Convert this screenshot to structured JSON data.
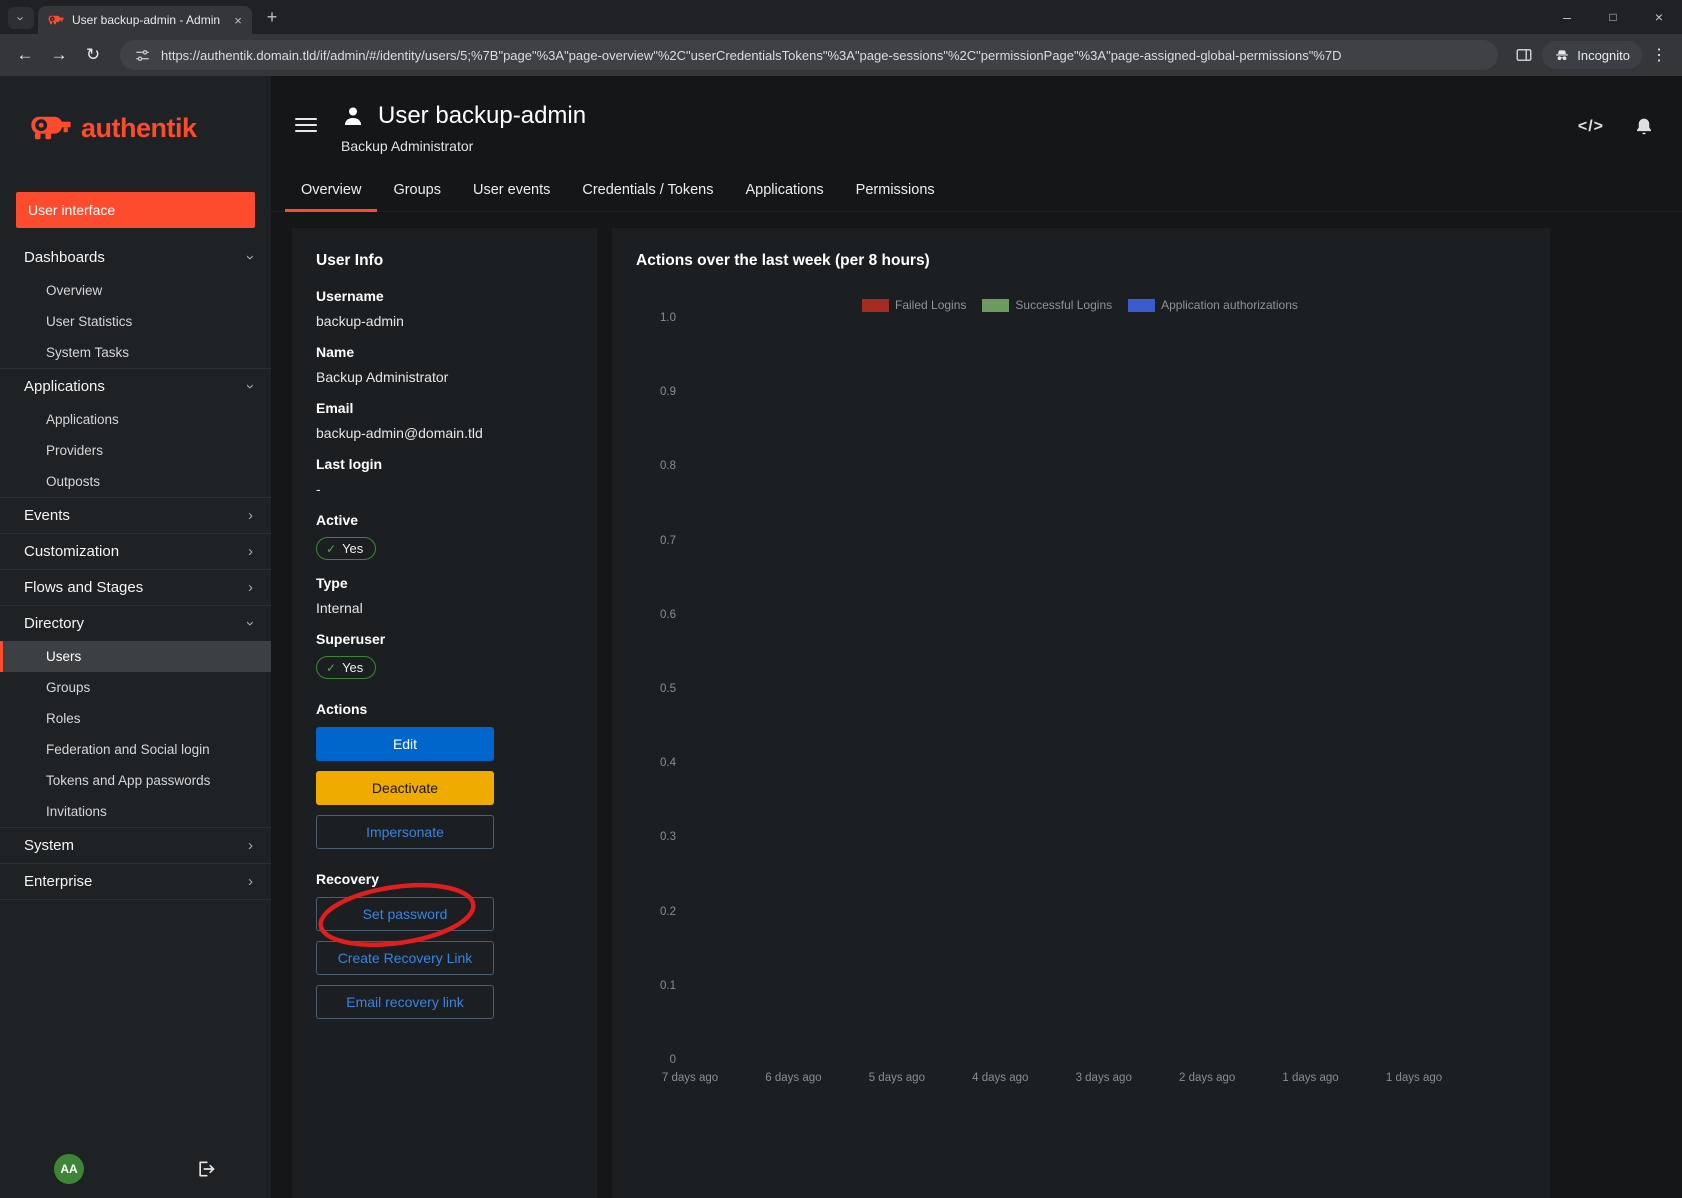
{
  "browser": {
    "tab_title": "User backup-admin - Admin - a",
    "url": "https://authentik.domain.tld/if/admin/#/identity/users/5;%7B\"page\"%3A\"page-overview\"%2C\"userCredentialsTokens\"%3A\"page-sessions\"%2C\"permissionPage\"%3A\"page-assigned-global-permissions\"%7D",
    "incognito_label": "Incognito"
  },
  "icons": {
    "tab_search_chevron": "›",
    "close_tab": "×",
    "new_tab": "+",
    "minimize": "–",
    "maximize": "□",
    "close_window": "×",
    "back": "←",
    "forward": "→",
    "reload": "↻",
    "menu": "⋮",
    "chevron": "›",
    "check": "✓",
    "code": "</>"
  },
  "colors": {
    "accent": "#fd4b2d",
    "primary_button": "#0066cc",
    "warning_button": "#f0ab00",
    "link": "#3a83de",
    "success": "#3e8635",
    "annotation": "#e01e1e"
  },
  "sidebar": {
    "brand": "authentik",
    "interface_button": "User interface",
    "sections": [
      {
        "label": "Dashboards",
        "state": "expanded",
        "children": [
          {
            "label": "Overview"
          },
          {
            "label": "User Statistics"
          },
          {
            "label": "System Tasks"
          }
        ]
      },
      {
        "label": "Applications",
        "state": "expanded",
        "children": [
          {
            "label": "Applications"
          },
          {
            "label": "Providers"
          },
          {
            "label": "Outposts"
          }
        ]
      },
      {
        "label": "Events",
        "state": "collapsed",
        "children": []
      },
      {
        "label": "Customization",
        "state": "collapsed",
        "children": []
      },
      {
        "label": "Flows and Stages",
        "state": "collapsed",
        "children": []
      },
      {
        "label": "Directory",
        "state": "expanded",
        "children": [
          {
            "label": "Users",
            "selected": true
          },
          {
            "label": "Groups"
          },
          {
            "label": "Roles"
          },
          {
            "label": "Federation and Social login"
          },
          {
            "label": "Tokens and App passwords"
          },
          {
            "label": "Invitations"
          }
        ]
      },
      {
        "label": "System",
        "state": "collapsed",
        "children": []
      },
      {
        "label": "Enterprise",
        "state": "collapsed",
        "children": []
      }
    ],
    "avatar_initials": "AA"
  },
  "header": {
    "title": "User backup-admin",
    "subtitle": "Backup Administrator"
  },
  "tabs": [
    {
      "label": "Overview",
      "active": true
    },
    {
      "label": "Groups"
    },
    {
      "label": "User events"
    },
    {
      "label": "Credentials / Tokens"
    },
    {
      "label": "Applications"
    },
    {
      "label": "Permissions"
    }
  ],
  "user_info": {
    "title": "User Info",
    "fields": [
      {
        "label": "Username",
        "value": "backup-admin"
      },
      {
        "label": "Name",
        "value": "Backup Administrator"
      },
      {
        "label": "Email",
        "value": "backup-admin@domain.tld"
      },
      {
        "label": "Last login",
        "value": "-"
      },
      {
        "label": "Active",
        "badge": "Yes"
      },
      {
        "label": "Type",
        "value": "Internal"
      },
      {
        "label": "Superuser",
        "badge": "Yes"
      }
    ],
    "actions_label": "Actions",
    "actions": [
      {
        "label": "Edit",
        "style": "primary"
      },
      {
        "label": "Deactivate",
        "style": "warning"
      },
      {
        "label": "Impersonate",
        "style": "outline"
      }
    ],
    "recovery_label": "Recovery",
    "recovery": [
      {
        "label": "Set password",
        "style": "outline",
        "annotated": true
      },
      {
        "label": "Create Recovery Link",
        "style": "outline"
      },
      {
        "label": "Email recovery link",
        "style": "outline"
      }
    ]
  },
  "chart_data": {
    "type": "line",
    "title": "Actions over the last week (per 8 hours)",
    "x": [
      "7 days ago",
      "6 days ago",
      "5 days ago",
      "4 days ago",
      "3 days ago",
      "2 days ago",
      "1 days ago",
      "1 days ago"
    ],
    "series": [
      {
        "name": "Failed Logins",
        "color": "#a52a1f",
        "values": [
          0,
          0,
          0,
          0,
          0,
          0,
          0,
          0
        ]
      },
      {
        "name": "Successful Logins",
        "color": "#6c9a5f",
        "values": [
          0,
          0,
          0,
          0,
          0,
          0,
          0,
          0
        ]
      },
      {
        "name": "Application authorizations",
        "color": "#3a5ccc",
        "values": [
          0,
          0,
          0,
          0,
          0,
          0,
          0,
          0
        ]
      }
    ],
    "ylim": [
      0,
      1.0
    ],
    "yticks": [
      "0",
      "0.1",
      "0.2",
      "0.3",
      "0.4",
      "0.5",
      "0.6",
      "0.7",
      "0.8",
      "0.9",
      "1.0"
    ],
    "grid": false,
    "legend_position": "top-right"
  }
}
